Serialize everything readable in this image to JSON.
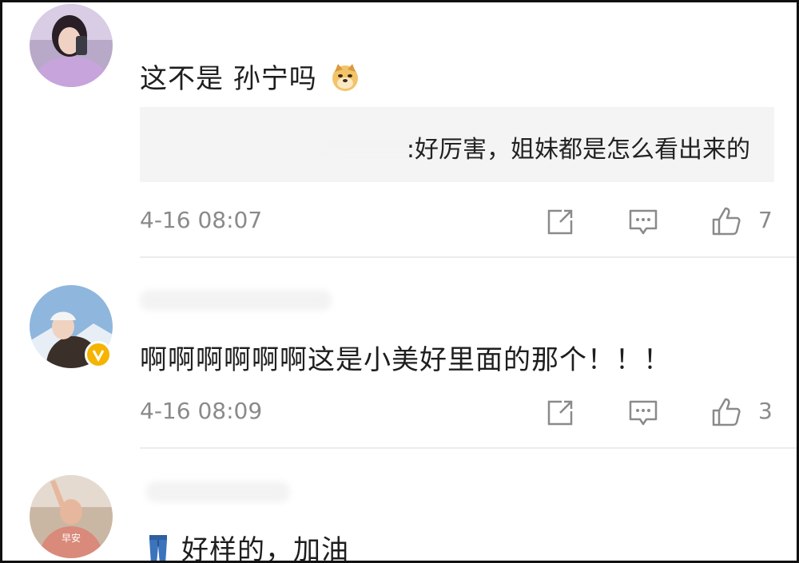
{
  "comments": [
    {
      "text": "这不是 孙宁吗",
      "emoji": "doge-emoji",
      "reply": ":好厉害，姐妹都是怎么看出来的",
      "time": "4-16 08:07",
      "likes": "7"
    },
    {
      "text": "啊啊啊啊啊啊这是小美好里面的那个！！！",
      "time": "4-16 08:09",
      "likes": "3",
      "verified": true
    },
    {
      "text": "好样的，加油",
      "emoji": "jeans-emoji",
      "avatar_label": "早安"
    }
  ],
  "icons": {
    "share": "share-icon",
    "comment": "comment-icon",
    "like": "thumbs-up-icon"
  },
  "colors": {
    "badge": "#f5b400",
    "reply_bg": "#f4f4f4",
    "meta_text": "#8a8a8a"
  }
}
